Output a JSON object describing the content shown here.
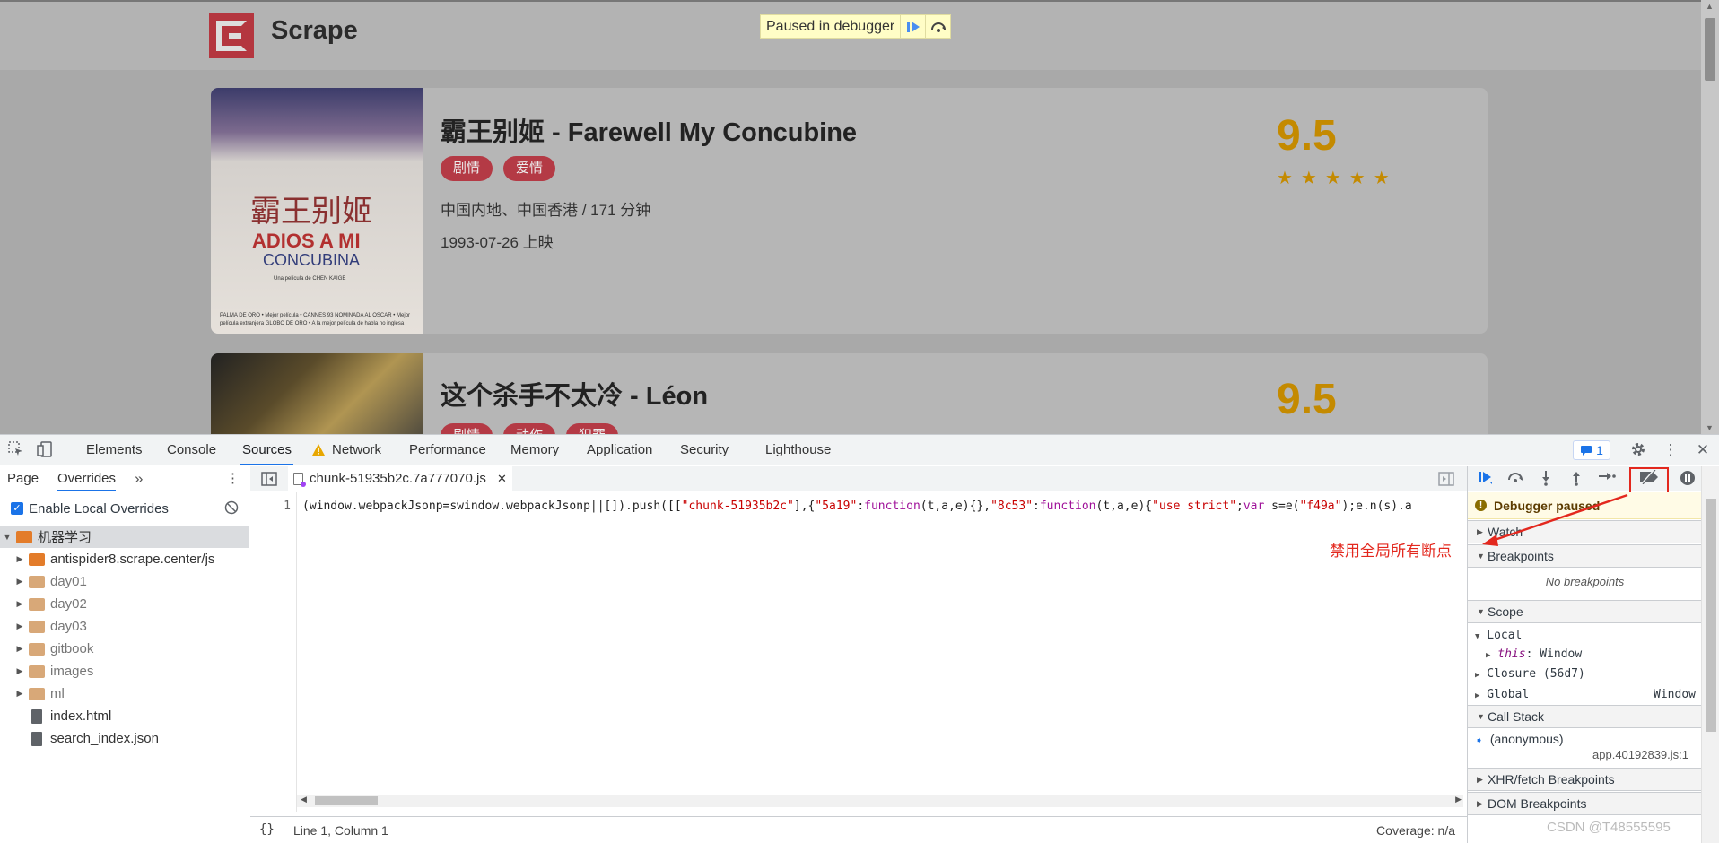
{
  "site": {
    "title": "Scrape",
    "paused_banner": "Paused in debugger"
  },
  "movies": [
    {
      "title": "霸王别姬 - Farewell My Concubine",
      "tags": [
        "剧情",
        "爱情"
      ],
      "region_duration": "中国内地、中国香港 / 171 分钟",
      "release": "1993-07-26 上映",
      "score": "9.5",
      "stars": "★★★★★",
      "poster_text": {
        "cn": "霸王别姬",
        "en1": "ADIOS A MI",
        "en2": "CONCUBINA",
        "credit": "Una película de CHEN KAIGE",
        "small": "PALMA DE ORO • Mejor película • CANNES 93 NOMINADA AL OSCAR • Mejor película extranjera GLOBO DE ORO • A la mejor película de habla no inglesa"
      }
    },
    {
      "title": "这个杀手不太冷 - Léon",
      "tags": [
        "剧情",
        "动作",
        "犯罪"
      ],
      "score": "9.5"
    }
  ],
  "devtools": {
    "tabs": [
      "Elements",
      "Console",
      "Sources",
      "Network",
      "Performance",
      "Memory",
      "Application",
      "Security",
      "Lighthouse"
    ],
    "active_tab": "Sources",
    "issues_count": "1",
    "navigator": {
      "tabs": [
        "Page",
        "Overrides"
      ],
      "active": "Overrides",
      "more": "»",
      "enable_overrides_label": "Enable Local Overrides",
      "root": "机器学习",
      "items": [
        {
          "name": "antispider8.scrape.center/js",
          "type": "folder",
          "dim": false
        },
        {
          "name": "day01",
          "type": "folder",
          "dim": true
        },
        {
          "name": "day02",
          "type": "folder",
          "dim": true
        },
        {
          "name": "day03",
          "type": "folder",
          "dim": true
        },
        {
          "name": "gitbook",
          "type": "folder",
          "dim": true
        },
        {
          "name": "images",
          "type": "folder",
          "dim": true
        },
        {
          "name": "ml",
          "type": "folder",
          "dim": true
        },
        {
          "name": "index.html",
          "type": "file",
          "dim": false
        },
        {
          "name": "search_index.json",
          "type": "file",
          "dim": false
        }
      ]
    },
    "editor": {
      "file_tab": "chunk-51935b2c.7a777070.js",
      "line_number": "1",
      "code_parts": [
        {
          "t": "(window.webpackJsonp=swindow.webpackJsonp||[]).push([[",
          "c": ""
        },
        {
          "t": "\"chunk-51935b2c\"",
          "c": "str"
        },
        {
          "t": "],{",
          "c": ""
        },
        {
          "t": "\"5a19\"",
          "c": "str"
        },
        {
          "t": ":",
          "c": ""
        },
        {
          "t": "function",
          "c": "kw"
        },
        {
          "t": "(t,a,e){},",
          "c": ""
        },
        {
          "t": "\"8c53\"",
          "c": "str"
        },
        {
          "t": ":",
          "c": ""
        },
        {
          "t": "function",
          "c": "kw"
        },
        {
          "t": "(t,a,e){",
          "c": ""
        },
        {
          "t": "\"use strict\"",
          "c": "str"
        },
        {
          "t": ";",
          "c": ""
        },
        {
          "t": "var",
          "c": "kw"
        },
        {
          "t": " s=e(",
          "c": ""
        },
        {
          "t": "\"f49a\"",
          "c": "str"
        },
        {
          "t": ");e.n(s).a",
          "c": ""
        }
      ],
      "braces": "{}",
      "cursor": "Line 1, Column 1",
      "coverage": "Coverage: n/a"
    },
    "debugger": {
      "paused_title": "Debugger paused",
      "sections": {
        "watch": "Watch",
        "breakpoints": "Breakpoints",
        "no_breakpoints": "No breakpoints",
        "scope": "Scope",
        "local": "Local",
        "this_key": "this",
        "this_val": ": Window",
        "closure": "Closure (56d7)",
        "global": "Global",
        "global_val": "Window",
        "call_stack": "Call Stack",
        "frame": "(anonymous)",
        "frame_loc": "app.40192839.js:1",
        "xhr": "XHR/fetch Breakpoints",
        "dom": "DOM Breakpoints"
      }
    }
  },
  "annotation": {
    "text": "禁用全局所有断点",
    "color": "#e3281e"
  },
  "watermark": "CSDN @T48555595",
  "colors": {
    "accent_blue": "#1a73e8",
    "tag_red": "#b43a45",
    "score_gold": "#c48a00",
    "annotation_red": "#e3281e"
  }
}
